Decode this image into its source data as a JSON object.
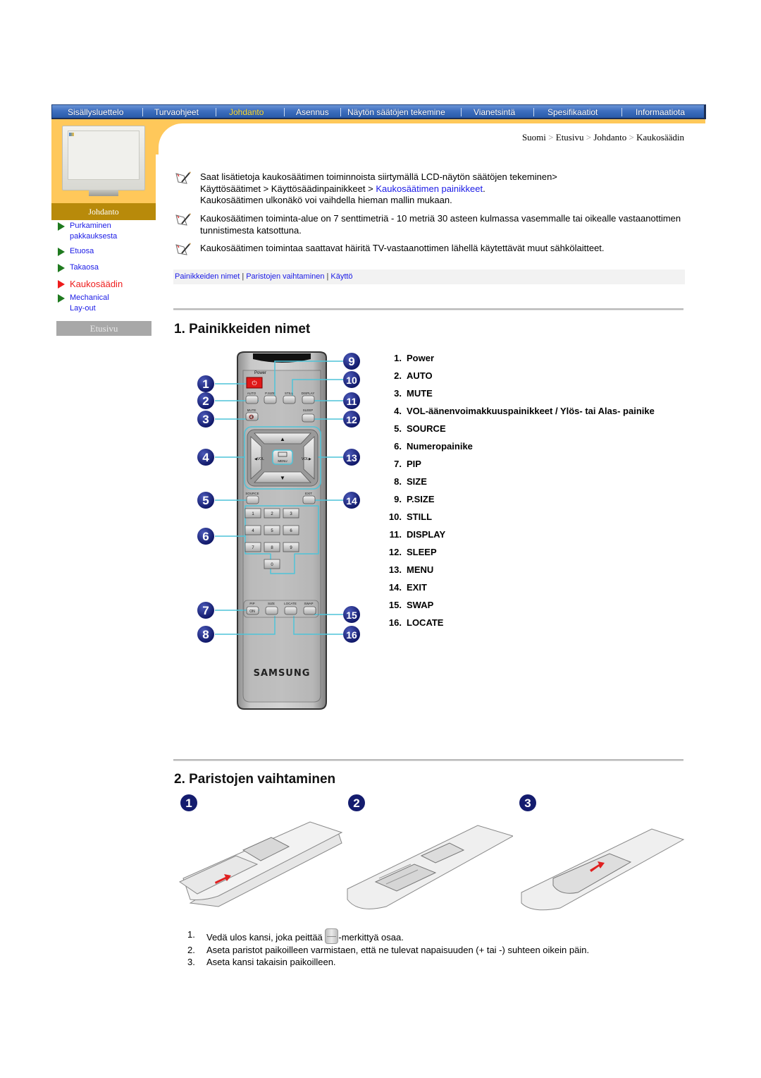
{
  "nav": {
    "items": [
      {
        "label": "Sisällysluettelo",
        "active": false
      },
      {
        "label": "Turvaohjeet",
        "active": false
      },
      {
        "label": "Johdanto",
        "active": true
      },
      {
        "label": "Asennus",
        "active": false
      },
      {
        "label": "Näytön säätöjen tekemine",
        "active": false
      },
      {
        "label": "Vianetsintä",
        "active": false
      },
      {
        "label": "Spesifikaatiot",
        "active": false
      },
      {
        "label": "Informaatiota",
        "active": false
      }
    ],
    "active_color": "#ffe23a"
  },
  "sidebar": {
    "section_title": "Johdanto",
    "items": [
      {
        "label": "Purkaminen pakkauksesta",
        "active": false
      },
      {
        "label": "Etuosa",
        "active": false
      },
      {
        "label": "Takaosa",
        "active": false
      },
      {
        "label": "Kaukosäädin",
        "active": true
      },
      {
        "label": "Mechanical Lay-out",
        "active": false
      }
    ],
    "home_button": "Etusivu"
  },
  "breadcrumb": [
    "Suomi",
    "Etusivu",
    "Johdanto",
    "Kaukosäädin"
  ],
  "notes": [
    {
      "line1": "Saat lisätietoja kaukosäätimen toiminnoista siirtymällä LCD-näytön säätöjen tekeminen>",
      "line2_prefix": "Käyttösäätimet > Käyttösäädinpainikkeet > ",
      "line2_link": "Kaukosäätimen painikkeet",
      "line2_suffix": ".",
      "line3": "Kaukosäätimen ulkonäkö voi vaihdella hieman mallin mukaan."
    },
    {
      "text": "Kaukosäätimen toiminta-alue on 7 senttimetriä - 10 metriä 30 asteen kulmassa vasemmalle tai oikealle vastaanottimen tunnistimesta katsottuna."
    },
    {
      "text": "Kaukosäätimen toimintaa saattavat häiritä TV-vastaanottimen lähellä käytettävät muut sähkölaitteet."
    }
  ],
  "subnav": [
    "Painikkeiden nimet",
    "Paristojen vaihtaminen",
    "Käyttö"
  ],
  "section1": {
    "title": "1. Painikkeiden nimet",
    "buttons": [
      {
        "num": "1.",
        "label": "Power"
      },
      {
        "num": "2.",
        "label": "AUTO"
      },
      {
        "num": "3.",
        "label": "MUTE"
      },
      {
        "num": "4.",
        "label": "VOL-äänenvoimakkuuspainikkeet / Ylös- tai Alas- painike"
      },
      {
        "num": "5.",
        "label": "SOURCE"
      },
      {
        "num": "6.",
        "label": "Numeropainike"
      },
      {
        "num": "7.",
        "label": "PIP"
      },
      {
        "num": "8.",
        "label": "SIZE"
      },
      {
        "num": "9.",
        "label": "P.SIZE"
      },
      {
        "num": "10.",
        "label": "STILL"
      },
      {
        "num": "11.",
        "label": "DISPLAY"
      },
      {
        "num": "12.",
        "label": "SLEEP"
      },
      {
        "num": "13.",
        "label": "MENU"
      },
      {
        "num": "14.",
        "label": "EXIT"
      },
      {
        "num": "15.",
        "label": "SWAP"
      },
      {
        "num": "16.",
        "label": "LOCATE"
      }
    ],
    "remote_labels": {
      "power": "Power",
      "auto": "AUTO",
      "psize": "P.SIZE",
      "still": "STILL",
      "display": "DISPLAY",
      "mute": "MUTE",
      "sleep": "SLEEP",
      "vol_left": "◀VOL",
      "vol_right": "VOL▶",
      "menu": "MENU",
      "source": "SOURCE",
      "exit": "EXIT",
      "digits": [
        "1",
        "2",
        "3",
        "4",
        "5",
        "6",
        "7",
        "8",
        "9",
        "0"
      ],
      "pip": "PIP",
      "pip_on": "ON",
      "size": "SIZE",
      "locate": "LOCATE",
      "swap": "SWAP",
      "brand": "SAMSUNG"
    },
    "callouts": [
      "1",
      "2",
      "3",
      "4",
      "5",
      "6",
      "7",
      "8",
      "9",
      "10",
      "11",
      "12",
      "13",
      "14",
      "15",
      "16"
    ]
  },
  "section2": {
    "title": "2. Paristojen vaihtaminen",
    "step_badges": [
      "1",
      "2",
      "3"
    ],
    "steps": [
      {
        "num": "1.",
        "before": "Vedä ulos kansi, joka peittää ",
        "after": "-merkittyä osaa."
      },
      {
        "num": "2.",
        "text": "Aseta paristot paikoilleen varmistaen, että ne tulevat napaisuuden (+ tai -) suhteen oikein päin."
      },
      {
        "num": "3.",
        "text": "Aseta kansi takaisin paikoilleen."
      }
    ]
  }
}
